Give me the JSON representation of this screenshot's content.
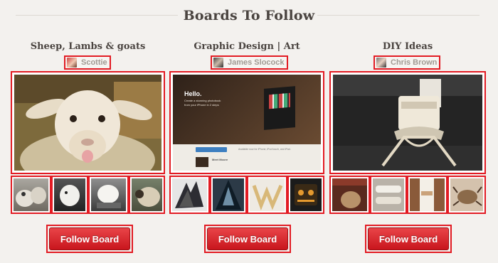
{
  "section": {
    "title": "Boards To Follow"
  },
  "boards": [
    {
      "title": "Sheep, Lambs & goats",
      "owner": "Scottie",
      "follow_label": "Follow Board"
    },
    {
      "title": "Graphic Design | Art",
      "owner": "James Slocock",
      "follow_label": "Follow Board",
      "cover_text": {
        "hello": "Hello.",
        "line1": "Create a stunning photobook",
        "line2": "from your iPhone in 2 steps",
        "available": "Available now for iPhone, iPod touch, and iPad.",
        "meet": "Meet Moore"
      }
    },
    {
      "title": "DIY Ideas",
      "owner": "Chris Brown",
      "follow_label": "Follow Board"
    }
  ],
  "colors": {
    "highlight": "#e21b23",
    "button": "#d6252b",
    "muted_text": "#a19a93"
  }
}
